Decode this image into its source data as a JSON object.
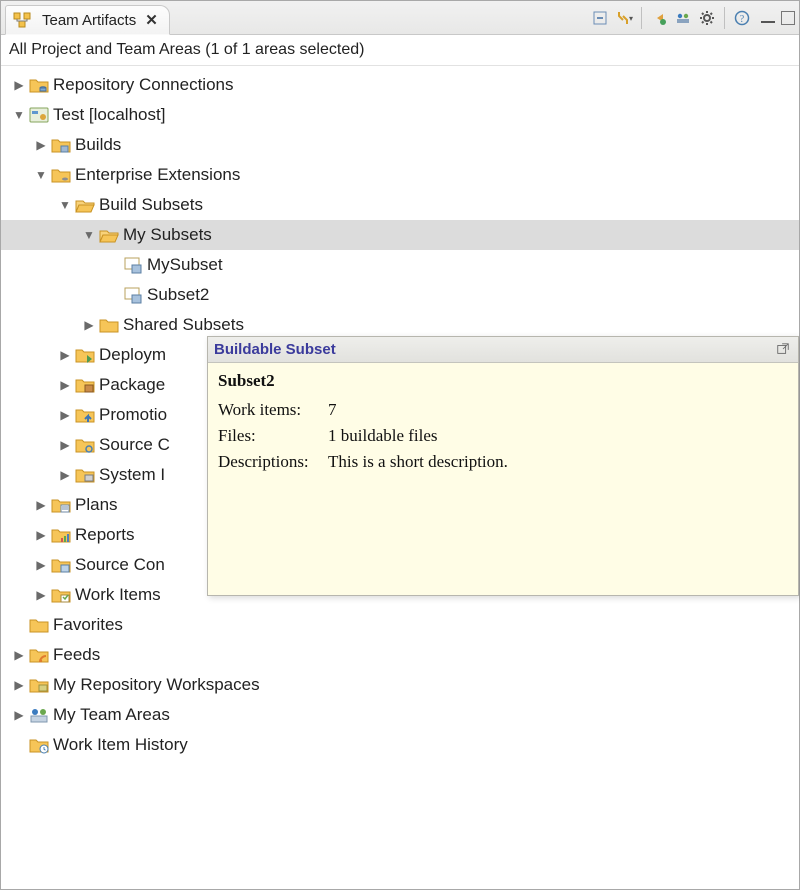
{
  "view": {
    "tab_title": "Team Artifacts",
    "close_glyph": "✕",
    "toolbar": {
      "collapse_icon": "collapse-icon",
      "link_icon": "link-with-editor-icon",
      "nav_back_icon": "navigate-back-icon",
      "nav_team_icon": "team-hub-icon",
      "gear_icon": "view-menu-icon",
      "help_icon": "help-icon"
    }
  },
  "filter_text": "All Project and Team Areas (1 of 1 areas selected)",
  "tree": {
    "repo_connections": "Repository Connections",
    "project": "Test [localhost]",
    "builds": "Builds",
    "ent_ext": "Enterprise Extensions",
    "build_subsets": "Build Subsets",
    "my_subsets": "My Subsets",
    "mysubset": "MySubset",
    "subset2": "Subset2",
    "shared_subsets": "Shared Subsets",
    "deployment": "Deploym",
    "packages": "Package",
    "promotions": "Promotio",
    "source_config": "Source C",
    "system_def": "System I",
    "plans": "Plans",
    "reports": "Reports",
    "source_con": "Source Con",
    "work_items": "Work Items",
    "favorites": "Favorites",
    "feeds": "Feeds",
    "my_repo_ws": "My Repository Workspaces",
    "my_team_areas": "My Team Areas",
    "work_item_history": "Work Item History"
  },
  "hover": {
    "title": "Buildable Subset",
    "name": "Subset2",
    "rows": {
      "work_items_k": "Work items:",
      "work_items_v": "7",
      "files_k": "Files:",
      "files_v": "1 buildable files",
      "desc_k": "Descriptions:",
      "desc_v": "This is a short description."
    }
  }
}
